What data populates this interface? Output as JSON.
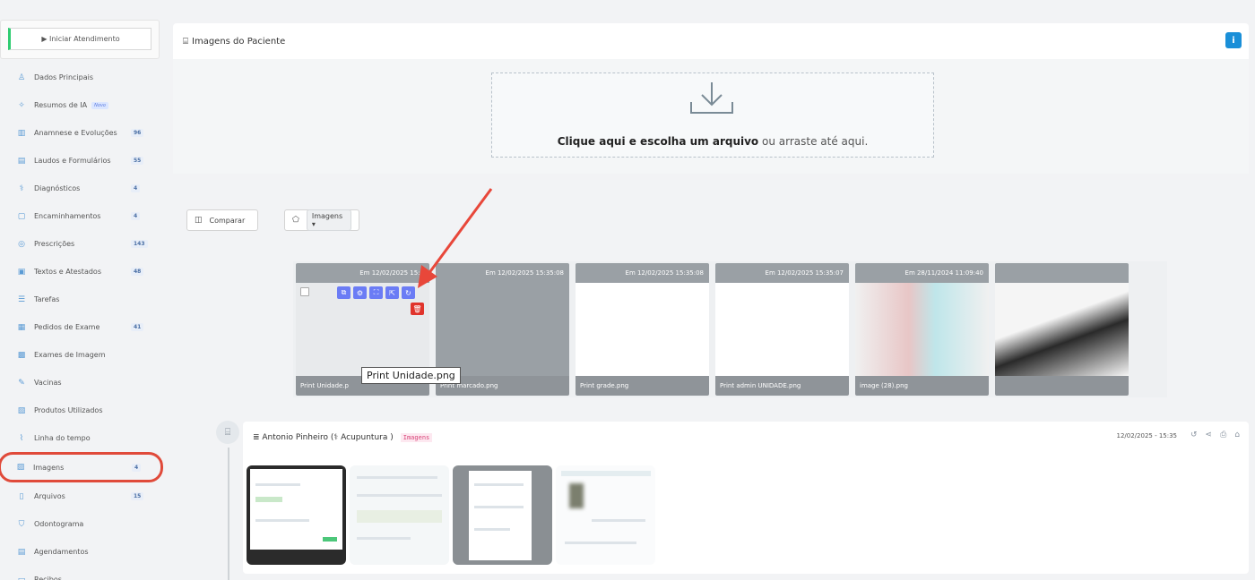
{
  "sidebar": {
    "start_button": "▶ Iniciar Atendimento",
    "items": [
      {
        "label": "Dados Principais",
        "icon": "user-icon",
        "glyph": "♙",
        "badge": ""
      },
      {
        "label": "Resumos de IA",
        "icon": "ai-sparkle-icon",
        "glyph": "✧",
        "badge": "",
        "new": "Novo"
      },
      {
        "label": "Anamnese e Evoluções",
        "icon": "chart-icon",
        "glyph": "▥",
        "badge": "96"
      },
      {
        "label": "Laudos e Formulários",
        "icon": "clipboard-icon",
        "glyph": "▤",
        "badge": "55"
      },
      {
        "label": "Diagnósticos",
        "icon": "stethoscope-icon",
        "glyph": "⚕",
        "badge": "4"
      },
      {
        "label": "Encaminhamentos",
        "icon": "document-icon",
        "glyph": "▢",
        "badge": "4"
      },
      {
        "label": "Prescrições",
        "icon": "pills-icon",
        "glyph": "◎",
        "badge": "143"
      },
      {
        "label": "Textos e Atestados",
        "icon": "file-text-icon",
        "glyph": "▣",
        "badge": "48"
      },
      {
        "label": "Tarefas",
        "icon": "list-icon",
        "glyph": "☰",
        "badge": ""
      },
      {
        "label": "Pedidos de Exame",
        "icon": "exam-icon",
        "glyph": "▦",
        "badge": "41"
      },
      {
        "label": "Exames de Imagem",
        "icon": "xray-icon",
        "glyph": "▩",
        "badge": ""
      },
      {
        "label": "Vacinas",
        "icon": "syringe-icon",
        "glyph": "✎",
        "badge": ""
      },
      {
        "label": "Produtos Utilizados",
        "icon": "box-icon",
        "glyph": "▧",
        "badge": ""
      },
      {
        "label": "Linha do tempo",
        "icon": "timeline-icon",
        "glyph": "⌇",
        "badge": ""
      },
      {
        "label": "Imagens",
        "icon": "image-icon",
        "glyph": "▨",
        "badge": "4",
        "active": true
      },
      {
        "label": "Arquivos",
        "icon": "file-icon",
        "glyph": "▯",
        "badge": "15"
      },
      {
        "label": "Odontograma",
        "icon": "tooth-icon",
        "glyph": "⛉",
        "badge": ""
      },
      {
        "label": "Agendamentos",
        "icon": "calendar-icon",
        "glyph": "▤",
        "badge": ""
      },
      {
        "label": "Recibos",
        "icon": "receipt-icon",
        "glyph": "▭",
        "badge": ""
      }
    ]
  },
  "panel": {
    "title": "Imagens do Paciente",
    "info_glyph": "i",
    "dropzone_bold": "Clique aqui e escolha um arquivo",
    "dropzone_rest": " ou arraste até aqui."
  },
  "toolbar": {
    "compare_label": "Comparar",
    "tag_label": "Imagens ▾"
  },
  "cards": [
    {
      "date": "Em 12/02/2025 15:3",
      "filename": "Print Unidade.p"
    },
    {
      "date": "Em 12/02/2025 15:35:08",
      "filename": "Print marcado.png"
    },
    {
      "date": "Em 12/02/2025 15:35:08",
      "filename": "Print grade.png"
    },
    {
      "date": "Em 12/02/2025 15:35:07",
      "filename": "Print admin UNIDADE.png"
    },
    {
      "date": "Em 28/11/2024 11:09:40",
      "filename": "image (28).png"
    },
    {
      "date": "",
      "filename": ""
    }
  ],
  "tooltip": "Print Unidade.png",
  "entry": {
    "title": "≣ Antonio Pinheiro  (⚕ Acupuntura )",
    "tag": "Imagens",
    "date": "12/02/2025 - 15:35"
  },
  "colors": {
    "accent": "#1a8fd8",
    "active_outline": "#e04a3a",
    "arrow": "#e8473a",
    "tool": "#6b7cf5"
  }
}
